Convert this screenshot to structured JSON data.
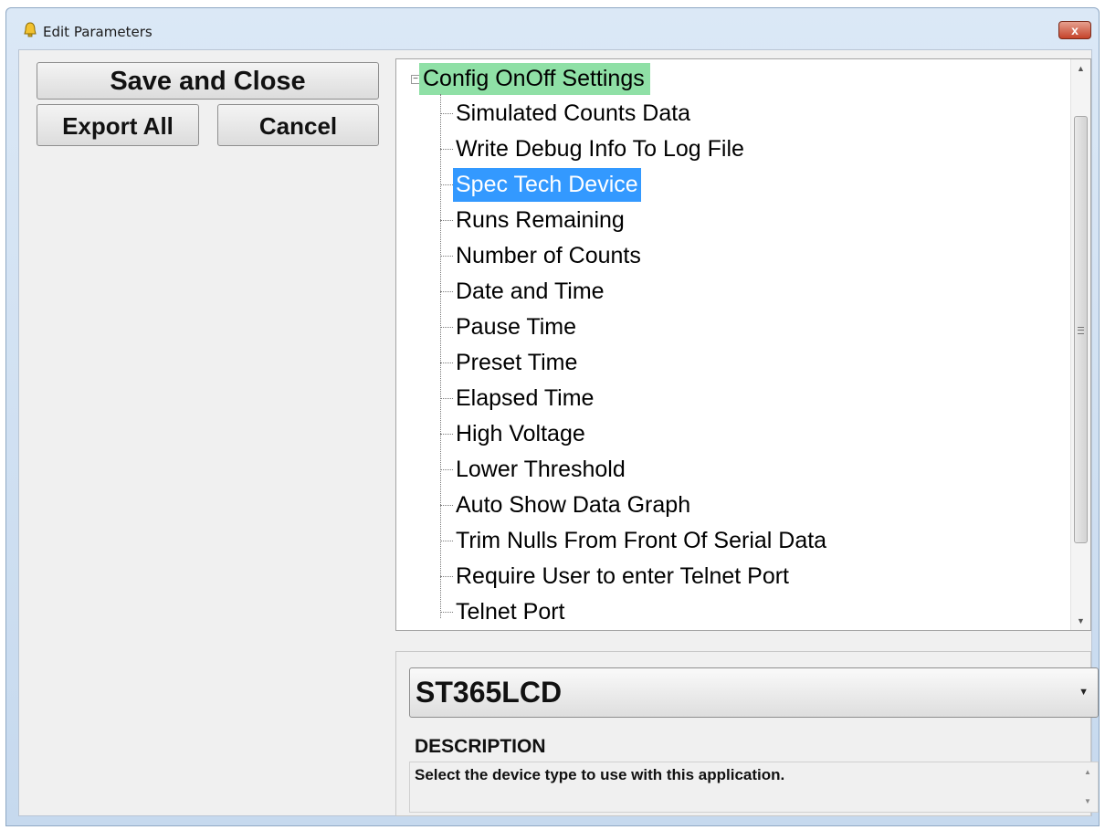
{
  "window": {
    "title": "Edit Parameters",
    "close_label": "x"
  },
  "buttons": {
    "save_close": "Save and Close",
    "export_all": "Export All",
    "cancel": "Cancel"
  },
  "tree": {
    "root": {
      "label": "Config OnOff Settings",
      "expander": "−"
    },
    "items": [
      {
        "label": "Simulated Counts Data"
      },
      {
        "label": "Write Debug Info To Log File"
      },
      {
        "label": "Spec Tech Device"
      },
      {
        "label": "Runs Remaining"
      },
      {
        "label": "Number of Counts"
      },
      {
        "label": "Date and Time"
      },
      {
        "label": "Pause Time"
      },
      {
        "label": "Preset Time"
      },
      {
        "label": "Elapsed Time"
      },
      {
        "label": "High Voltage"
      },
      {
        "label": "Lower Threshold"
      },
      {
        "label": "Auto Show Data Graph"
      },
      {
        "label": "Trim Nulls From Front Of Serial Data"
      },
      {
        "label": "Require User to enter Telnet Port"
      },
      {
        "label": "Telnet Port"
      }
    ],
    "selected_index": 2
  },
  "value_dropdown": {
    "selected": "ST365LCD"
  },
  "description": {
    "title": "DESCRIPTION",
    "text": "Select the device type to use with this application."
  },
  "colors": {
    "root_highlight": "#8fe0a6",
    "selection": "#3399ff",
    "close_button": "#c5432a"
  }
}
